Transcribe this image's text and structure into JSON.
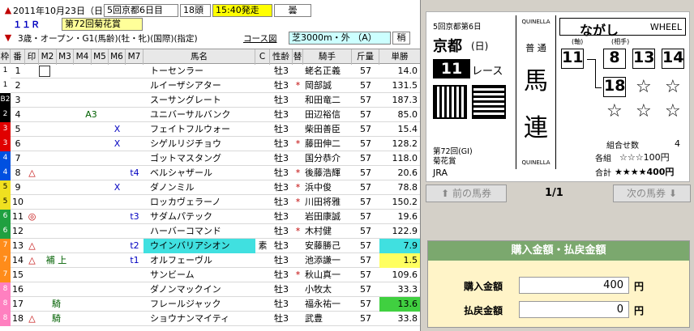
{
  "header": {
    "date": "2011年10月23日（日）",
    "meeting": "5回京都6日目",
    "runners": "18頭",
    "post_time": "15:40発走",
    "weather": "曇",
    "race_no": "１１Ｒ",
    "race_name": "第72回菊花賞",
    "conditions": "3歳・オープン・G1(馬齢)(牡・牝)(国際)(指定)",
    "course_btn": "コース図",
    "course": "芝3000m・外 （A）",
    "going": "稍"
  },
  "columns": [
    "枠",
    "番",
    "印",
    "M2",
    "M3",
    "M4",
    "M5",
    "M6",
    "M7",
    "馬名",
    "C",
    "性齢",
    "替",
    "騎手",
    "斤量",
    "単勝"
  ],
  "rows": [
    {
      "waku": "1",
      "wc": "#ffffff",
      "wt": "#000000",
      "ban": "1",
      "m3": "",
      "m4": "",
      "m5": "",
      "m6": "",
      "m7": "",
      "name": "トーセンラー",
      "c": "",
      "sex": "牡3",
      "change": "",
      "jockey": "蛯名正義",
      "kin": "57",
      "odds": "14.0",
      "hl": ""
    },
    {
      "waku": "1",
      "wc": "#ffffff",
      "wt": "#000000",
      "ban": "2",
      "m3": "",
      "m4": "",
      "m5": "",
      "m6": "",
      "m7": "",
      "name": "ルイーザシアター",
      "c": "",
      "sex": "牡3",
      "change": "*",
      "jockey": "岡部誠",
      "kin": "57",
      "odds": "131.5",
      "hl": ""
    },
    {
      "waku": "B2",
      "wc": "#000000",
      "wt": "#ffffff",
      "ban": "3",
      "m3": "",
      "m4": "",
      "m5": "",
      "m6": "",
      "m7": "",
      "name": "スーサングレート",
      "c": "",
      "sex": "牡3",
      "change": "",
      "jockey": "和田竜二",
      "kin": "57",
      "odds": "187.3",
      "hl": ""
    },
    {
      "waku": "2",
      "wc": "#000000",
      "wt": "#ffffff",
      "ban": "4",
      "m3": "",
      "m4": "A3",
      "m5": "",
      "m6": "",
      "m7": "",
      "name": "ユニバーサルバンク",
      "c": "",
      "sex": "牡3",
      "change": "",
      "jockey": "田辺裕信",
      "kin": "57",
      "odds": "85.0",
      "hl": ""
    },
    {
      "waku": "3",
      "wc": "#e00000",
      "wt": "#ffffff",
      "ban": "5",
      "m3": "",
      "m4": "",
      "m5": "",
      "m6": "X",
      "m7": "",
      "name": "フェイトフルウォー",
      "c": "",
      "sex": "牡3",
      "change": "",
      "jockey": "柴田善臣",
      "kin": "57",
      "odds": "15.4",
      "hl": ""
    },
    {
      "waku": "3",
      "wc": "#e00000",
      "wt": "#ffffff",
      "ban": "6",
      "m3": "",
      "m4": "",
      "m5": "",
      "m6": "X",
      "m7": "",
      "name": "シゲルリジチョウ",
      "c": "",
      "sex": "牡3",
      "change": "*",
      "jockey": "藤田伸二",
      "kin": "57",
      "odds": "128.2",
      "hl": ""
    },
    {
      "waku": "4",
      "wc": "#0050e0",
      "wt": "#ffffff",
      "ban": "7",
      "m3": "",
      "m4": "",
      "m5": "",
      "m6": "",
      "m7": "",
      "name": "ゴットマスタング",
      "c": "",
      "sex": "牡3",
      "change": "",
      "jockey": "国分恭介",
      "kin": "57",
      "odds": "118.0",
      "hl": ""
    },
    {
      "waku": "4",
      "wc": "#0050e0",
      "wt": "#ffffff",
      "ban": "8",
      "mark": "△",
      "m3": "",
      "m4": "",
      "m5": "",
      "m6": "",
      "m7": "t4",
      "name": "ベルシャザール",
      "c": "",
      "sex": "牡3",
      "change": "*",
      "jockey": "後藤浩輝",
      "kin": "57",
      "odds": "20.6",
      "hl": ""
    },
    {
      "waku": "5",
      "wc": "#f0e020",
      "wt": "#000000",
      "ban": "9",
      "m3": "",
      "m4": "",
      "m5": "",
      "m6": "X",
      "m7": "",
      "name": "ダノンミル",
      "c": "",
      "sex": "牡3",
      "change": "*",
      "jockey": "浜中俊",
      "kin": "57",
      "odds": "78.8",
      "hl": ""
    },
    {
      "waku": "5",
      "wc": "#f0e020",
      "wt": "#000000",
      "ban": "10",
      "m3": "",
      "m4": "",
      "m5": "",
      "m6": "",
      "m7": "",
      "name": "ロッカヴェラーノ",
      "c": "",
      "sex": "牡3",
      "change": "*",
      "jockey": "川田将雅",
      "kin": "57",
      "odds": "150.2",
      "hl": ""
    },
    {
      "waku": "6",
      "wc": "#20a040",
      "wt": "#ffffff",
      "ban": "11",
      "mark": "◎",
      "m3": "",
      "m4": "",
      "m5": "",
      "m6": "",
      "m7": "t3",
      "name": "サダムパテック",
      "c": "",
      "sex": "牡3",
      "change": "",
      "jockey": "岩田康誠",
      "kin": "57",
      "odds": "19.6",
      "hl": ""
    },
    {
      "waku": "6",
      "wc": "#20a040",
      "wt": "#ffffff",
      "ban": "12",
      "m3": "",
      "m4": "",
      "m5": "",
      "m6": "",
      "m7": "",
      "name": "ハーバーコマンド",
      "c": "",
      "sex": "牡3",
      "change": "*",
      "jockey": "木村健",
      "kin": "57",
      "odds": "122.9",
      "hl": ""
    },
    {
      "waku": "7",
      "wc": "#ff8c1a",
      "wt": "#ffffff",
      "ban": "13",
      "mark": "△",
      "m3": "",
      "m4": "",
      "m5": "",
      "m6": "",
      "m7": "t2",
      "name": "ウインバリアシオン",
      "c": "素",
      "sex": "牡3",
      "change": "",
      "jockey": "安藤勝己",
      "kin": "57",
      "odds": "7.9",
      "hl": "#40e0e0"
    },
    {
      "waku": "7",
      "wc": "#ff8c1a",
      "wt": "#ffffff",
      "ban": "14",
      "mark": "△",
      "m3": "補 上",
      "m4": "",
      "m5": "",
      "m6": "",
      "m7": "t1",
      "name": "オルフェーヴル",
      "c": "",
      "sex": "牡3",
      "change": "",
      "jockey": "池添謙一",
      "kin": "57",
      "odds": "1.5",
      "hl": "#ffff60"
    },
    {
      "waku": "7",
      "wc": "#ff8c1a",
      "wt": "#ffffff",
      "ban": "15",
      "m3": "",
      "m4": "",
      "m5": "",
      "m6": "",
      "m7": "",
      "name": "サンビーム",
      "c": "",
      "sex": "牡3",
      "change": "*",
      "jockey": "秋山真一",
      "kin": "57",
      "odds": "109.6",
      "hl": ""
    },
    {
      "waku": "8",
      "wc": "#ff80c0",
      "wt": "#ffffff",
      "ban": "16",
      "m3": "",
      "m4": "",
      "m5": "",
      "m6": "",
      "m7": "",
      "name": "ダノンマックイン",
      "c": "",
      "sex": "牡3",
      "change": "",
      "jockey": "小牧太",
      "kin": "57",
      "odds": "33.3",
      "hl": ""
    },
    {
      "waku": "8",
      "wc": "#ff80c0",
      "wt": "#ffffff",
      "ban": "17",
      "m3": "騎",
      "m4": "",
      "m5": "",
      "m6": "",
      "m7": "",
      "name": "フレールジャック",
      "c": "",
      "sex": "牡3",
      "change": "",
      "jockey": "福永祐一",
      "kin": "57",
      "odds": "13.6",
      "hl": "#40d040"
    },
    {
      "waku": "8",
      "wc": "#ff80c0",
      "wt": "#ffffff",
      "ban": "18",
      "mark": "△",
      "m3": "騎",
      "m4": "",
      "m5": "",
      "m6": "",
      "m7": "",
      "name": "ショウナンマイティ",
      "c": "",
      "sex": "牡3",
      "change": "",
      "jockey": "武豊",
      "kin": "57",
      "odds": "33.8",
      "hl": ""
    }
  ],
  "ticket": {
    "meeting": "5回京都第6日",
    "venue": "京都",
    "day": "(日)",
    "race": "11",
    "race_unit": "レース",
    "quinella_top": "QUINELLA",
    "quinella_bottom": "QUINELLA",
    "futsu": "普 通",
    "bet_type_1": "馬",
    "bet_type_2": "連",
    "nagashi": "ながし",
    "wheel": "WHEEL",
    "axis_label": "(軸)",
    "partner_label": "(相手)",
    "axis": "11",
    "partners": [
      "8",
      "13",
      "14",
      "18"
    ],
    "stars": [
      "☆",
      "☆",
      "☆",
      "☆",
      "☆",
      "☆"
    ],
    "race_caption_1": "第72回(GI)",
    "race_caption_2": "菊花賞",
    "jra": "JRA",
    "combos_label": "組合せ数",
    "combos": "4",
    "each_label": "各組",
    "each_value": "☆☆☆100円",
    "total_label": "合計",
    "total_value": "★★★★400円"
  },
  "nav": {
    "prev": "前の馬券",
    "next": "次の馬券",
    "page": "1/1"
  },
  "money": {
    "title": "購入金額・払戻金額",
    "buy_label": "購入金額",
    "buy_value": "400",
    "pay_label": "払戻金額",
    "pay_value": "0",
    "unit": "円"
  }
}
